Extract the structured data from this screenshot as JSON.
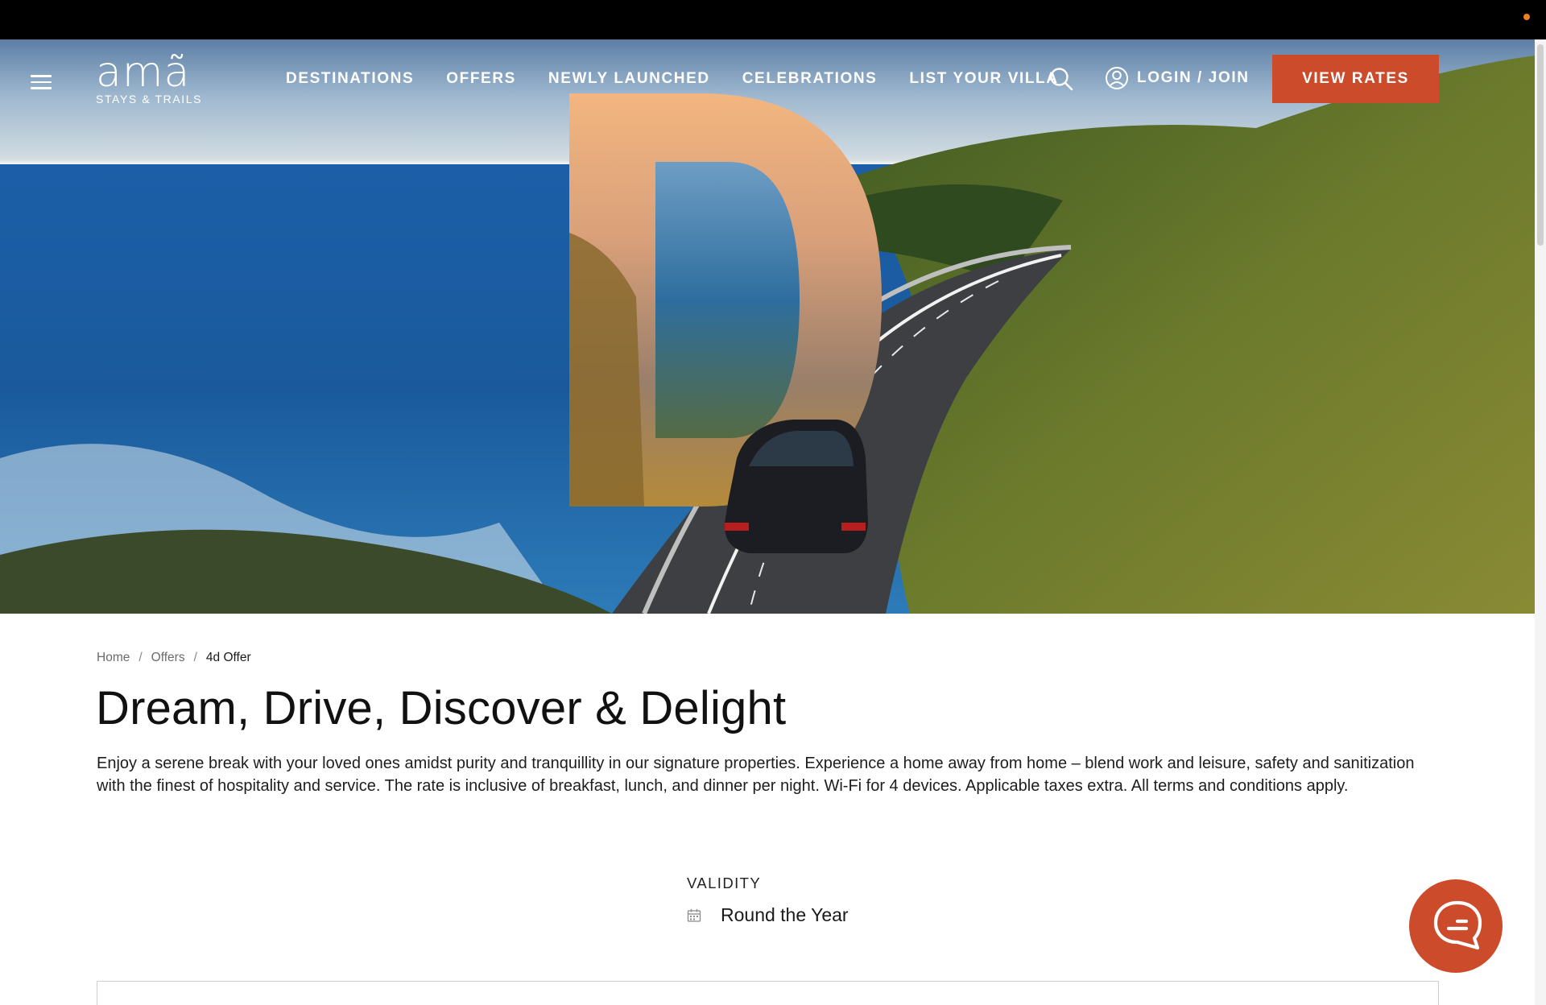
{
  "brand": {
    "name": "amã",
    "tagline": "STAYS & TRAILS"
  },
  "nav": {
    "links": [
      "DESTINATIONS",
      "OFFERS",
      "NEWLY LAUNCHED",
      "CELEBRATIONS",
      "LIST YOUR VILLA"
    ],
    "login_label": "LOGIN / JOIN",
    "cta_label": "VIEW RATES"
  },
  "breadcrumb": {
    "items": [
      "Home",
      "Offers"
    ],
    "current": "4d Offer"
  },
  "offer": {
    "title": "Dream, Drive, Discover & Delight",
    "description": "Enjoy a serene break with your loved ones amidst purity and tranquillity in our signature properties. Experience a home away from home – blend work and leisure, safety and sanitization with the finest of hospitality and service. The rate is inclusive of breakfast, lunch, and dinner per night. Wi-Fi for 4 devices. Applicable taxes extra. All terms and conditions apply.",
    "validity_label": "VALIDITY",
    "validity_value": "Round the Year"
  },
  "colors": {
    "accent": "#cc4b2a",
    "topbar": "#000000",
    "notification_dot": "#f07f22"
  },
  "icons": {
    "menu": "hamburger-menu-icon",
    "search": "search-icon",
    "user": "user-circle-icon",
    "calendar": "calendar-icon",
    "chat": "chat-bubble-icon"
  }
}
